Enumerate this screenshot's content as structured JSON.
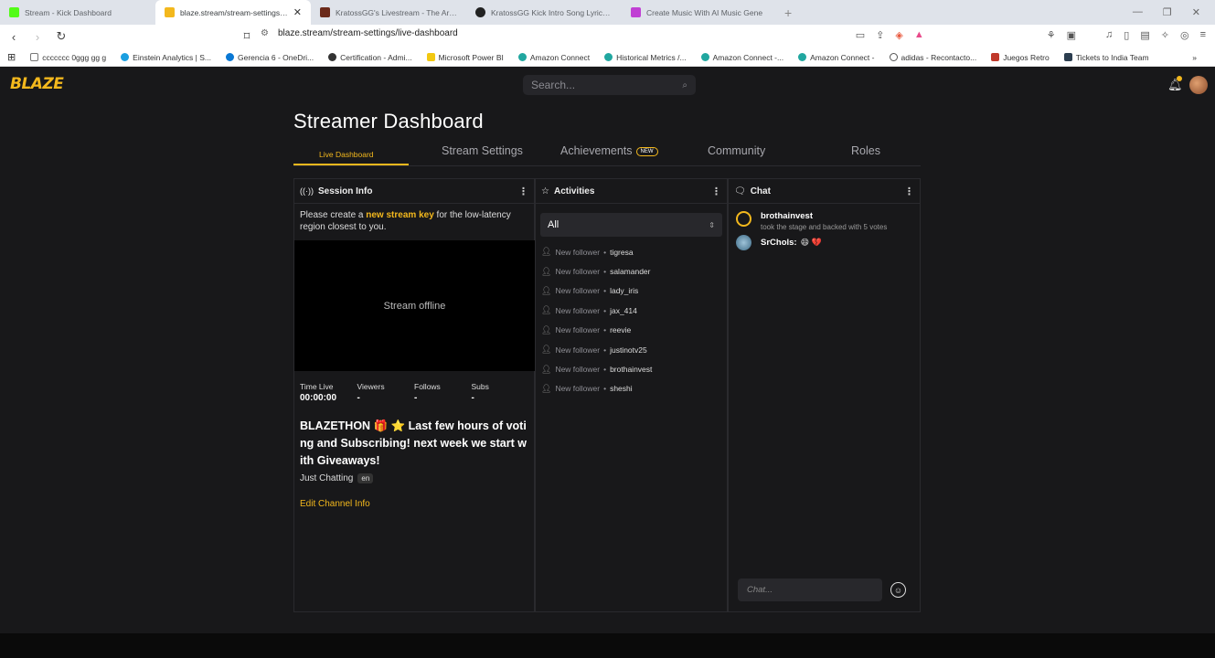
{
  "browser": {
    "tabs": [
      {
        "title": "Stream - Kick Dashboard",
        "color": "#53fc18"
      },
      {
        "title": "blaze.stream/stream-settings/liv",
        "color": "#f3b81d",
        "active": true
      },
      {
        "title": "KratossGG's Livestream - The Arena",
        "color": "#6b2a1a"
      },
      {
        "title": "KratossGG Kick Intro Song Lyrics - G",
        "color": "#222222"
      },
      {
        "title": "Create Music With AI Music Gene",
        "color": "#c03fd4"
      }
    ],
    "url": "blaze.stream/stream-settings/live-dashboard",
    "bookmarks": [
      {
        "label": "ccccccc 0ggg gg  g",
        "color": "#777777"
      },
      {
        "label": "Einstein Analytics | S...",
        "color": "#1b9fe0"
      },
      {
        "label": "Gerencia 6 - OneDri...",
        "color": "#0a78d4"
      },
      {
        "label": "Certification - Admi...",
        "color": "#333333"
      },
      {
        "label": "Microsoft Power BI",
        "color": "#f2c811"
      },
      {
        "label": "Amazon Connect",
        "color": "#21a7a0"
      },
      {
        "label": "Historical Metrics /...",
        "color": "#21a7a0"
      },
      {
        "label": "Amazon Connect -...",
        "color": "#21a7a0"
      },
      {
        "label": "Amazon Connect -",
        "color": "#21a7a0"
      },
      {
        "label": "adidas - Recontacto...",
        "color": "#555555"
      },
      {
        "label": "Juegos Retro",
        "color": "#c0392b"
      },
      {
        "label": "Tickets to India Team",
        "color": "#2c3e50"
      }
    ]
  },
  "site": {
    "logo": "BLAZE",
    "search_placeholder": "Search...",
    "page_title": "Streamer Dashboard",
    "nav": {
      "live": "Live Dashboard",
      "settings": "Stream Settings",
      "achievements": "Achievements",
      "new_badge": "NEW",
      "community": "Community",
      "roles": "Roles"
    }
  },
  "session": {
    "header": "Session Info",
    "note_pre": "Please create a ",
    "note_link": "new stream key",
    "note_post": " for the low-latency region closest to you.",
    "offline": "Stream offline",
    "stats": [
      {
        "label": "Time Live",
        "value": "00:00:00"
      },
      {
        "label": "Viewers",
        "value": "-"
      },
      {
        "label": "Follows",
        "value": "-"
      },
      {
        "label": "Subs",
        "value": "-"
      }
    ],
    "stream_title": "BLAZETHON 🎁 ⭐ Last few hours of voting and Subscribing! next week we start with Giveaways!",
    "category": "Just Chatting",
    "language": "en",
    "edit_link": "Edit Channel Info"
  },
  "activities": {
    "header": "Activities",
    "filter": "All",
    "items": [
      {
        "type": "New follower",
        "user": "tigresa"
      },
      {
        "type": "New follower",
        "user": "salamander"
      },
      {
        "type": "New follower",
        "user": "lady_iris"
      },
      {
        "type": "New follower",
        "user": "jax_414"
      },
      {
        "type": "New follower",
        "user": "reevie"
      },
      {
        "type": "New follower",
        "user": "justinotv25"
      },
      {
        "type": "New follower",
        "user": "brothainvest"
      },
      {
        "type": "New follower",
        "user": "sheshi"
      }
    ]
  },
  "chat": {
    "header": "Chat",
    "messages": [
      {
        "user": "brothainvest",
        "text": "took the stage and backed with 5 votes"
      },
      {
        "user": "SrChols:",
        "text": "😄 💔"
      }
    ],
    "input_placeholder": "Chat..."
  }
}
